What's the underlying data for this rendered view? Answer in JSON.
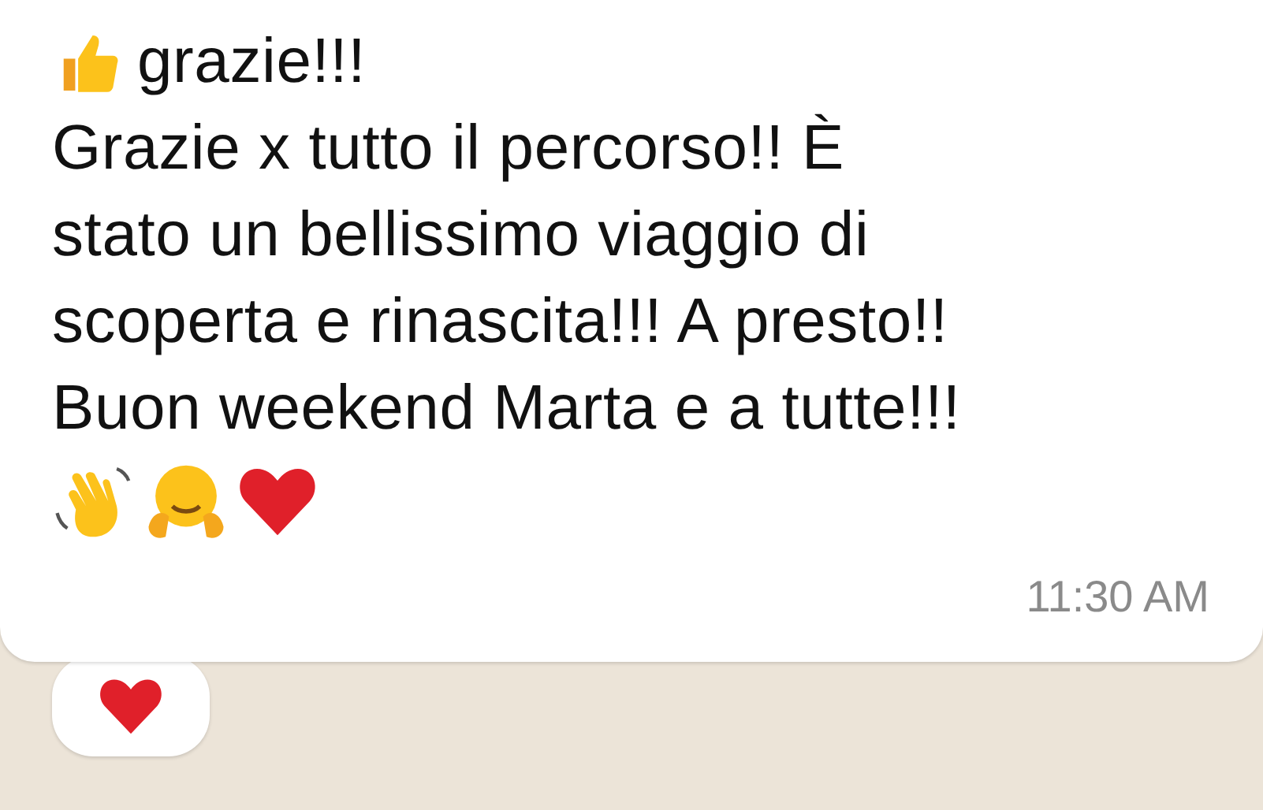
{
  "message": {
    "lead_emoji": {
      "kind": "thumbs-up"
    },
    "lines": [
      "grazie!!!",
      "Grazie x tutto il percorso!! È",
      "stato un bellissimo viaggio di",
      "scoperta e rinascita!!! A presto!!",
      "Buon weekend Marta e a tutte!!!"
    ],
    "emojis": [
      {
        "kind": "wave"
      },
      {
        "kind": "hug"
      },
      {
        "kind": "heart"
      }
    ],
    "time": "11:30 AM"
  },
  "reactions": [
    {
      "kind": "heart"
    }
  ]
}
